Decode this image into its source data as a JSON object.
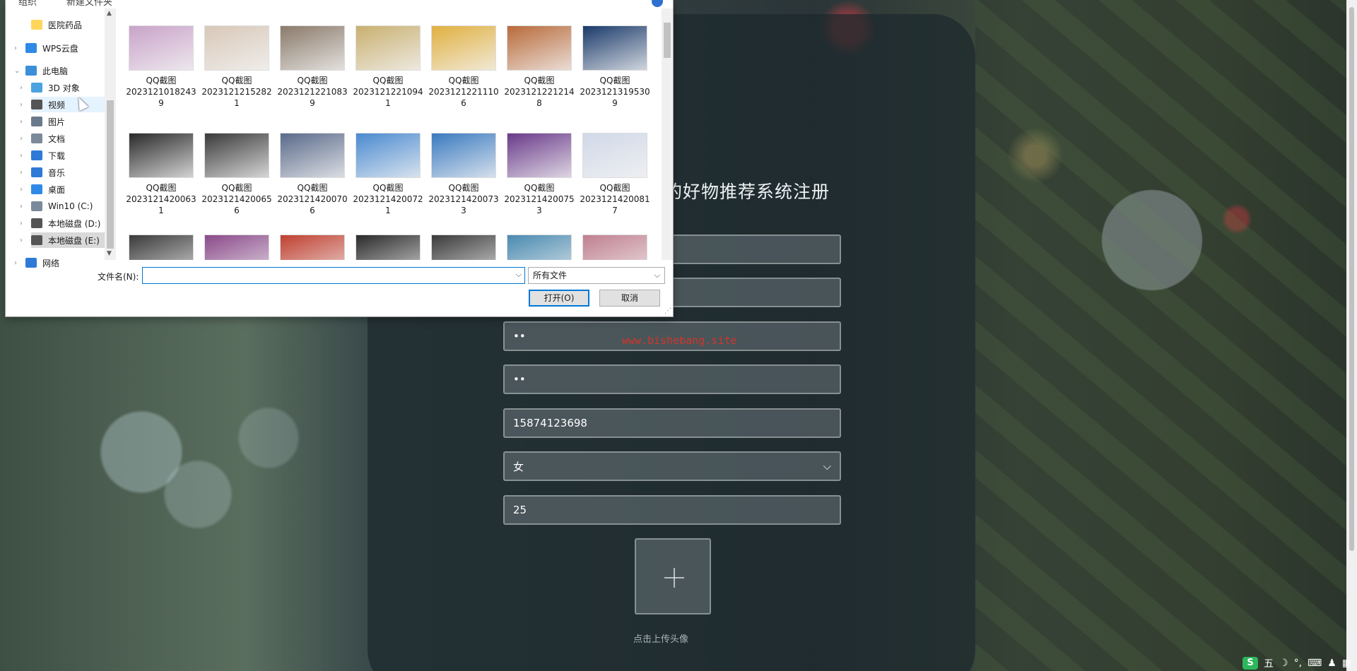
{
  "page": {
    "title": "的好物推荐系统注册",
    "watermark": "www.bishebang.site",
    "fields": [
      {
        "name": "field-1",
        "value": ""
      },
      {
        "name": "field-2",
        "value": ""
      },
      {
        "name": "password-field",
        "value": "••"
      },
      {
        "name": "confirm-password-field",
        "value": "••"
      },
      {
        "name": "phone-field",
        "value": "15874123698"
      },
      {
        "name": "gender-select",
        "value": "女"
      },
      {
        "name": "age-field",
        "value": "25"
      }
    ],
    "upload_hint": "点击上传头像"
  },
  "dialog": {
    "top_labels": [
      "组织",
      "新建文件夹"
    ],
    "nav": [
      {
        "label": "医院药品",
        "icon": "folder-icon",
        "color": "#ffd65c"
      },
      {
        "label": "WPS云盘",
        "icon": "cloud-icon",
        "color": "#2f8ae6"
      },
      {
        "label": "此电脑",
        "icon": "computer-icon",
        "color": "#3b8fd9"
      },
      {
        "label": "3D 对象",
        "icon": "cube-icon",
        "color": "#4aa3e0"
      },
      {
        "label": "视频",
        "icon": "video-icon",
        "color": "#555555"
      },
      {
        "label": "图片",
        "icon": "picture-icon",
        "color": "#6a7a8a"
      },
      {
        "label": "文档",
        "icon": "document-icon",
        "color": "#7a8a9a"
      },
      {
        "label": "下载",
        "icon": "download-icon",
        "color": "#2f7ad6"
      },
      {
        "label": "音乐",
        "icon": "music-icon",
        "color": "#2f7ad6"
      },
      {
        "label": "桌面",
        "icon": "desktop-icon",
        "color": "#2f8ae6"
      },
      {
        "label": "Win10 (C:)",
        "icon": "drive-icon",
        "color": "#7a8a9a"
      },
      {
        "label": "本地磁盘 (D:)",
        "icon": "drive-icon",
        "color": "#555555"
      },
      {
        "label": "本地磁盘 (E:)",
        "icon": "drive-icon",
        "color": "#555555"
      },
      {
        "label": "网络",
        "icon": "network-icon",
        "color": "#2f7ad6"
      }
    ],
    "files": [
      {
        "l1": "QQ截图",
        "l2": "2023121018243",
        "l3": "9",
        "color": "#c9a3c9"
      },
      {
        "l1": "QQ截图",
        "l2": "2023121215282",
        "l3": "1",
        "color": "#d8c8b8"
      },
      {
        "l1": "QQ截图",
        "l2": "2023121221083",
        "l3": "9",
        "color": "#8a7a6a"
      },
      {
        "l1": "QQ截图",
        "l2": "2023121221094",
        "l3": "1",
        "color": "#c9b070"
      },
      {
        "l1": "QQ截图",
        "l2": "2023121221110",
        "l3": "6",
        "color": "#e0b040"
      },
      {
        "l1": "QQ截图",
        "l2": "2023121221214",
        "l3": "8",
        "color": "#b86a3a"
      },
      {
        "l1": "QQ截图",
        "l2": "2023121319530",
        "l3": "9",
        "color": "#1a3a6a"
      },
      {
        "l1": "QQ截图",
        "l2": "2023121420063",
        "l3": "1",
        "color": "#2a2a2a"
      },
      {
        "l1": "QQ截图",
        "l2": "2023121420065",
        "l3": "6",
        "color": "#3a3a3a"
      },
      {
        "l1": "QQ截图",
        "l2": "2023121420070",
        "l3": "6",
        "color": "#5a6a8a"
      },
      {
        "l1": "QQ截图",
        "l2": "2023121420072",
        "l3": "1",
        "color": "#4a8ad0"
      },
      {
        "l1": "QQ截图",
        "l2": "2023121420073",
        "l3": "3",
        "color": "#3a7ac0"
      },
      {
        "l1": "QQ截图",
        "l2": "2023121420075",
        "l3": "3",
        "color": "#6a3a8a"
      },
      {
        "l1": "QQ截图",
        "l2": "2023121420081",
        "l3": "7",
        "color": "#d0d8e8"
      },
      {
        "l1": "",
        "l2": "",
        "l3": "",
        "color": "#3a3a3a"
      },
      {
        "l1": "",
        "l2": "",
        "l3": "",
        "color": "#8a4a8a"
      },
      {
        "l1": "",
        "l2": "",
        "l3": "",
        "color": "#c04030"
      },
      {
        "l1": "",
        "l2": "",
        "l3": "",
        "color": "#2a2a2a"
      },
      {
        "l1": "",
        "l2": "",
        "l3": "",
        "color": "#3a3a3a"
      },
      {
        "l1": "",
        "l2": "",
        "l3": "",
        "color": "#4a8ab0"
      },
      {
        "l1": "",
        "l2": "",
        "l3": "",
        "color": "#c08090"
      }
    ],
    "filename_label": "文件名(N):",
    "filename_value": "",
    "filetype": "所有文件",
    "open_label": "打开(O)",
    "cancel_label": "取消"
  },
  "tray": {
    "ime": "五",
    "items": [
      "☽",
      "°,",
      "⌨",
      "♟",
      "▦"
    ]
  }
}
